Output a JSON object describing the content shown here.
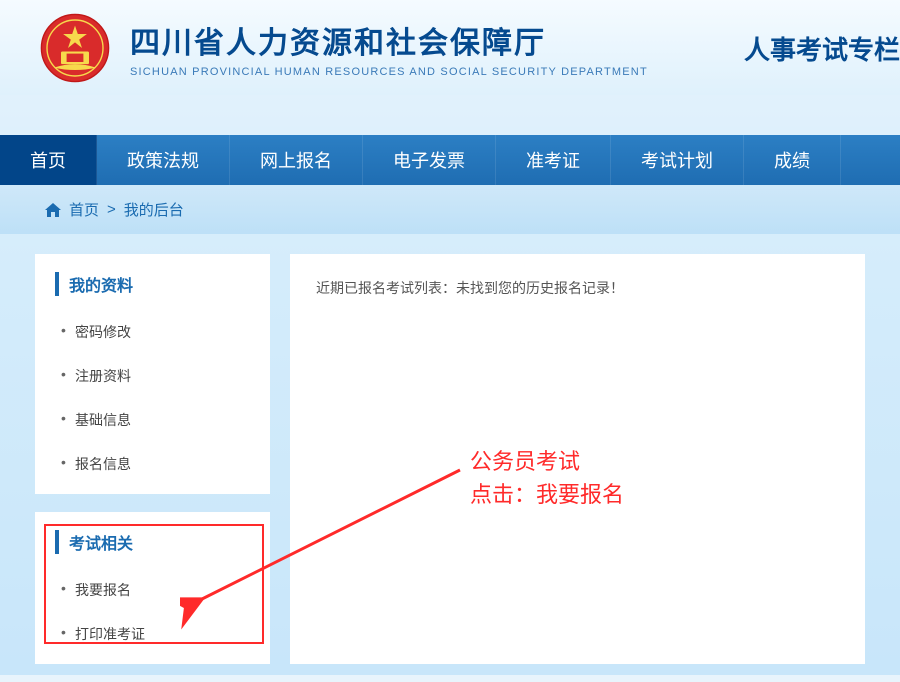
{
  "header": {
    "title_cn": "四川省人力资源和社会保障厅",
    "title_en": "SICHUAN PROVINCIAL HUMAN RESOURCES AND SOCIAL SECURITY DEPARTMENT",
    "side_label": "人事考试专栏"
  },
  "nav": {
    "items": [
      {
        "label": "首页",
        "active": true
      },
      {
        "label": "政策法规",
        "active": false
      },
      {
        "label": "网上报名",
        "active": false
      },
      {
        "label": "电子发票",
        "active": false
      },
      {
        "label": "准考证",
        "active": false
      },
      {
        "label": "考试计划",
        "active": false
      },
      {
        "label": "成绩",
        "active": false
      }
    ]
  },
  "breadcrumb": {
    "home": "首页",
    "sep": ">",
    "current": "我的后台"
  },
  "sidebar": {
    "panels": [
      {
        "title": "我的资料",
        "items": [
          "密码修改",
          "注册资料",
          "基础信息",
          "报名信息"
        ]
      },
      {
        "title": "考试相关",
        "items": [
          "我要报名",
          "打印准考证"
        ]
      }
    ]
  },
  "main": {
    "message": "近期已报名考试列表：未找到您的历史报名记录！"
  },
  "annotation": {
    "line1": "公务员考试",
    "line2": "点击：我要报名"
  }
}
